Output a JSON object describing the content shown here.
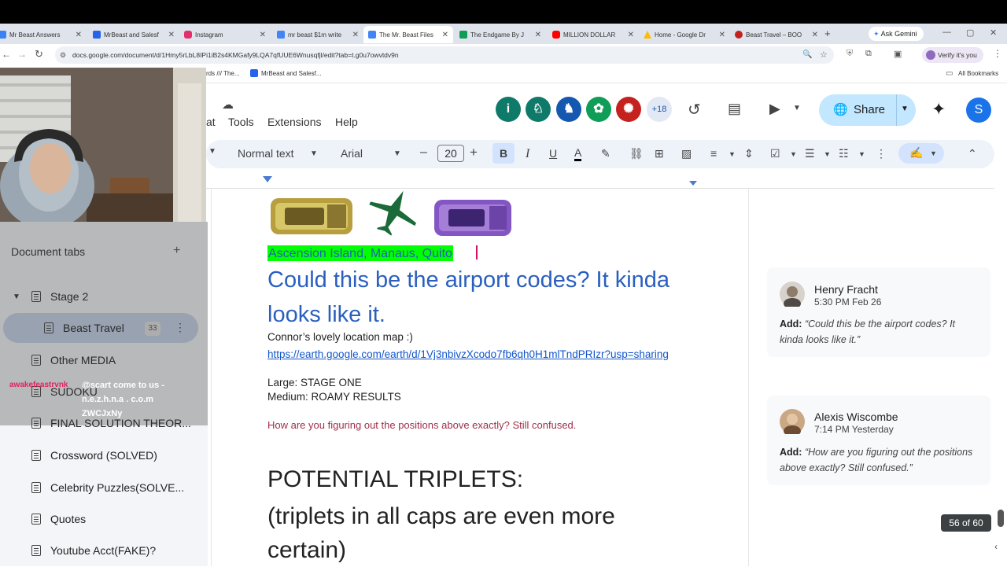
{
  "browser": {
    "tabs": [
      {
        "label": "Mr Beast Answers",
        "color": "#3b82f6"
      },
      {
        "label": "MrBeast and Salesf",
        "color": "#2563eb"
      },
      {
        "label": "Instagram",
        "color": "#e1306c"
      },
      {
        "label": "mr beast $1m write",
        "color": "#4285f4"
      },
      {
        "label": "The Mr. Beast Files",
        "color": "#4285f4"
      },
      {
        "label": "The Endgame By J",
        "color": "#0f9d58"
      },
      {
        "label": "MILLION DOLLAR",
        "color": "#ff0000"
      },
      {
        "label": "Home - Google Dr",
        "color": "#fbbc04"
      },
      {
        "label": "Beast Travel – BOO",
        "color": "#c5221f"
      }
    ],
    "new_tab_symbol": "+",
    "ask_gemini": "Ask Gemini",
    "url": "docs.google.com/document/d/1Hmy5rLbL8IPi1iB2s4KMGafy9LQA7qfUUE6Wnusqfjl/edit?tab=t.g0u7owvtdv9n",
    "verify": "Verify it's you",
    "bookmarks": [
      "rds /// The...",
      "MrBeast and Salesf..."
    ],
    "all_bookmarks": "All Bookmarks"
  },
  "docs": {
    "menu": [
      "at",
      "Tools",
      "Extensions",
      "Help"
    ],
    "collab_more": "+18",
    "share_label": "Share",
    "user_initial": "S",
    "collab_colors": [
      "#0f7a6a",
      "#0f7a6a",
      "#1558b0",
      "#0f9d58",
      "#c5221f"
    ]
  },
  "toolbar": {
    "style": "Normal text",
    "font": "Arial",
    "size": "20",
    "minus": "–",
    "plus": "+",
    "bold": "B",
    "italic": "I",
    "underline": "U",
    "text_color": "A"
  },
  "sidebar": {
    "title": "Document tabs",
    "add": "+",
    "items": [
      {
        "label": "Stage 2"
      },
      {
        "label": "Beast Travel",
        "badge": "33"
      },
      {
        "label": "Other MEDIA"
      },
      {
        "label": "SUDOKU"
      },
      {
        "label": "FINAL SOLUTION THEOR..."
      },
      {
        "label": "Crossword (SOLVED)"
      },
      {
        "label": "Celebrity Puzzles(SOLVE..."
      },
      {
        "label": "Quotes"
      },
      {
        "label": "Youtube Acct(FAKE)?"
      }
    ]
  },
  "overlay": {
    "user": "awakefeastrvnk",
    "line1": "@scart come to us -",
    "line2": "n.e.z.h.n.a . c.o.m",
    "line3": "ZWCJxNy"
  },
  "document": {
    "highlighted": "Ascension Island, Manaus, Quito",
    "heading": "Could this be the airport codes? It kinda looks like it.",
    "map_label": "Connor’s lovely location map :)",
    "link": "https://earth.google.com/earth/d/1Vj3nbivzXcodo7fb6qh0H1mlTndPRIzr?usp=sharing",
    "large": "Large: STAGE ONE",
    "medium": "Medium: ROAMY RESULTS",
    "question": "How are you figuring out the positions above exactly? Still confused.",
    "triplets_title": "POTENTIAL TRIPLETS:",
    "triplets_sub": "(triplets in all caps are even more certain)"
  },
  "comments": [
    {
      "name": "Henry Fracht",
      "time": "5:30 PM Feb 26",
      "prefix": "Add:",
      "text": "“Could this be the airport codes? It kinda looks like it.”"
    },
    {
      "name": "Alexis Wiscombe",
      "time": "7:14 PM Yesterday",
      "prefix": "Add:",
      "text": "“How are you figuring out the positions above exactly? Still confused.”"
    }
  ],
  "page_counter": "56 of 60"
}
